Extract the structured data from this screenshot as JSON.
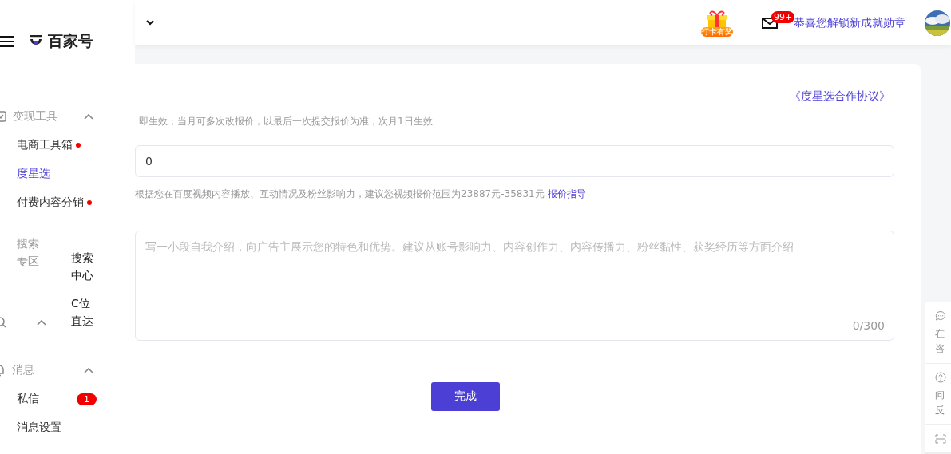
{
  "header": {
    "gift_badge": "打卡有奖",
    "mail_count": "99+",
    "achievement_link": "恭喜您解锁新成就勋章"
  },
  "sidebar": {
    "logo": "百家号",
    "groups": [
      {
        "kind": "section",
        "title": "变现工具",
        "expanded": true,
        "items": [
          {
            "label": "电商工具箱",
            "dot": true,
            "selected": false
          },
          {
            "label": "度星选",
            "dot": false,
            "selected": true
          },
          {
            "label": "付费内容分销",
            "dot": true,
            "selected": false
          }
        ]
      },
      {
        "kind": "split",
        "title": "搜索专区",
        "expanded": true,
        "items": [
          {
            "label": "搜索中心",
            "dot": false,
            "selected": false
          },
          {
            "label": "C位直达",
            "dot": false,
            "selected": false
          }
        ]
      },
      {
        "kind": "section",
        "title": "消息",
        "expanded": true,
        "items": [
          {
            "label": "私信",
            "dot": false,
            "selected": false,
            "badge": "1"
          },
          {
            "label": "消息设置",
            "dot": false,
            "selected": false
          }
        ]
      }
    ]
  },
  "form": {
    "agreement_link": "《度星选合作协议》",
    "notice": "即生效；当月可多次改报价，以最后一次提交报价为准，次月1日生效",
    "price_value": "0",
    "price_hint": "根据您在百度视频内容播放、互动情况及粉丝影响力，建议您视频报价范围为23887元-35831元",
    "price_hint_link": "报价指导",
    "intro_placeholder": "写一小段自我介绍，向广告主展示您的特色和优势。建议从账号影响力、内容创作力、内容传播力、粉丝黏性、获奖经历等方面介绍",
    "intro_counter": "0/300",
    "submit": "完成"
  },
  "float_panel": [
    {
      "kind": "chat",
      "lines": [
        "在",
        "咨"
      ]
    },
    {
      "kind": "help",
      "lines": [
        "问",
        "反"
      ]
    },
    {
      "kind": "scan"
    }
  ]
}
